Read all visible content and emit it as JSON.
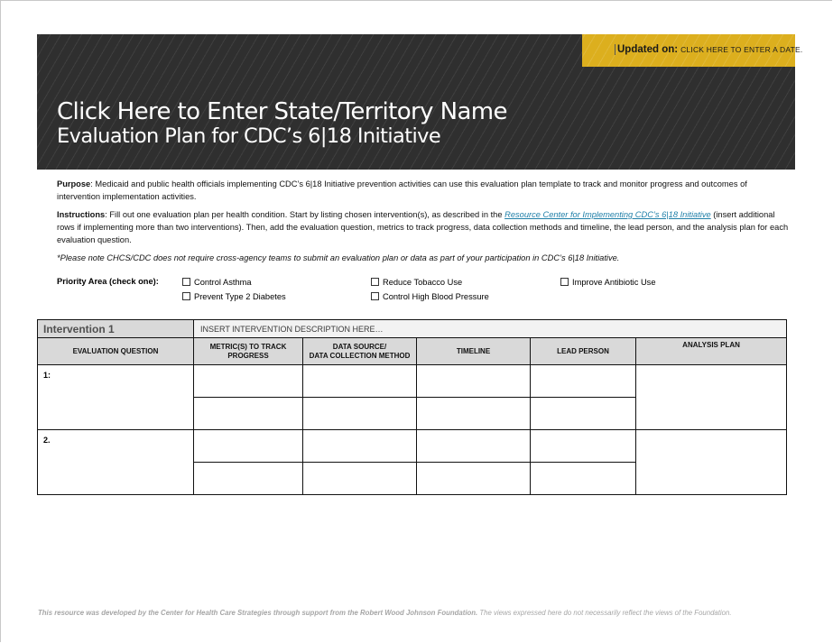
{
  "banner": {
    "updated_label": "Updated on:",
    "updated_value": "CLICK HERE TO ENTER A DATE.",
    "title_line1": "Click Here to Enter State/Territory Name",
    "title_line2": "Evaluation Plan for CDC’s 6|18 Initiative"
  },
  "intro": {
    "purpose_label": "Purpose",
    "purpose_text": ": Medicaid and public health officials implementing CDC’s 6|18 Initiative prevention activities can use this evaluation plan template to track and monitor progress and outcomes of intervention implementation activities.",
    "instructions_label": "Instructions",
    "instructions_text_before": ": Fill out one evaluation plan per health condition. Start by listing chosen intervention(s), as described in the ",
    "instructions_link": "Resource Center for Implementing CDC’s 6|18 Initiative",
    "instructions_text_after": " (insert additional rows if implementing more than two interventions). Then, add the evaluation question, metrics to track progress, data collection methods and timeline, the lead person, and the analysis plan for each evaluation question.",
    "note": "*Please note CHCS/CDC does not require cross-agency teams to submit an evaluation plan or data as part of your participation in CDC’s 6|18 Initiative."
  },
  "priority": {
    "label": "Priority Area (check one):",
    "options": [
      {
        "label": "Control Asthma",
        "checked": false
      },
      {
        "label": "Prevent Type 2  Diabetes",
        "checked": false
      },
      {
        "label": "Reduce Tobacco Use",
        "checked": false
      },
      {
        "label": "Control High Blood Pressure",
        "checked": false
      },
      {
        "label": "Improve Antibiotic Use",
        "checked": false
      }
    ]
  },
  "table": {
    "intervention_label": "Intervention 1",
    "intervention_placeholder": "INSERT INTERVENTION DESCRIPTION HERE…",
    "headers": {
      "question": "EVALUATION QUESTION",
      "metrics_1": "METRIC(S) TO TRACK",
      "metrics_2": "PROGRESS",
      "source_1": "DATA SOURCE/",
      "source_2": "DATA COLLECTION METHOD",
      "timeline": "TIMELINE",
      "lead": "LEAD PERSON",
      "analysis": "ANALYSIS PLAN"
    },
    "questions": [
      {
        "number": "1:"
      },
      {
        "number": "2."
      }
    ]
  },
  "footer": {
    "bold_text": "This resource was developed by the Center for Health Care Strategies through support from the Robert Wood Johnson Foundation.",
    "text": " The views expressed here do not necessarily reflect the views of the Foundation."
  }
}
